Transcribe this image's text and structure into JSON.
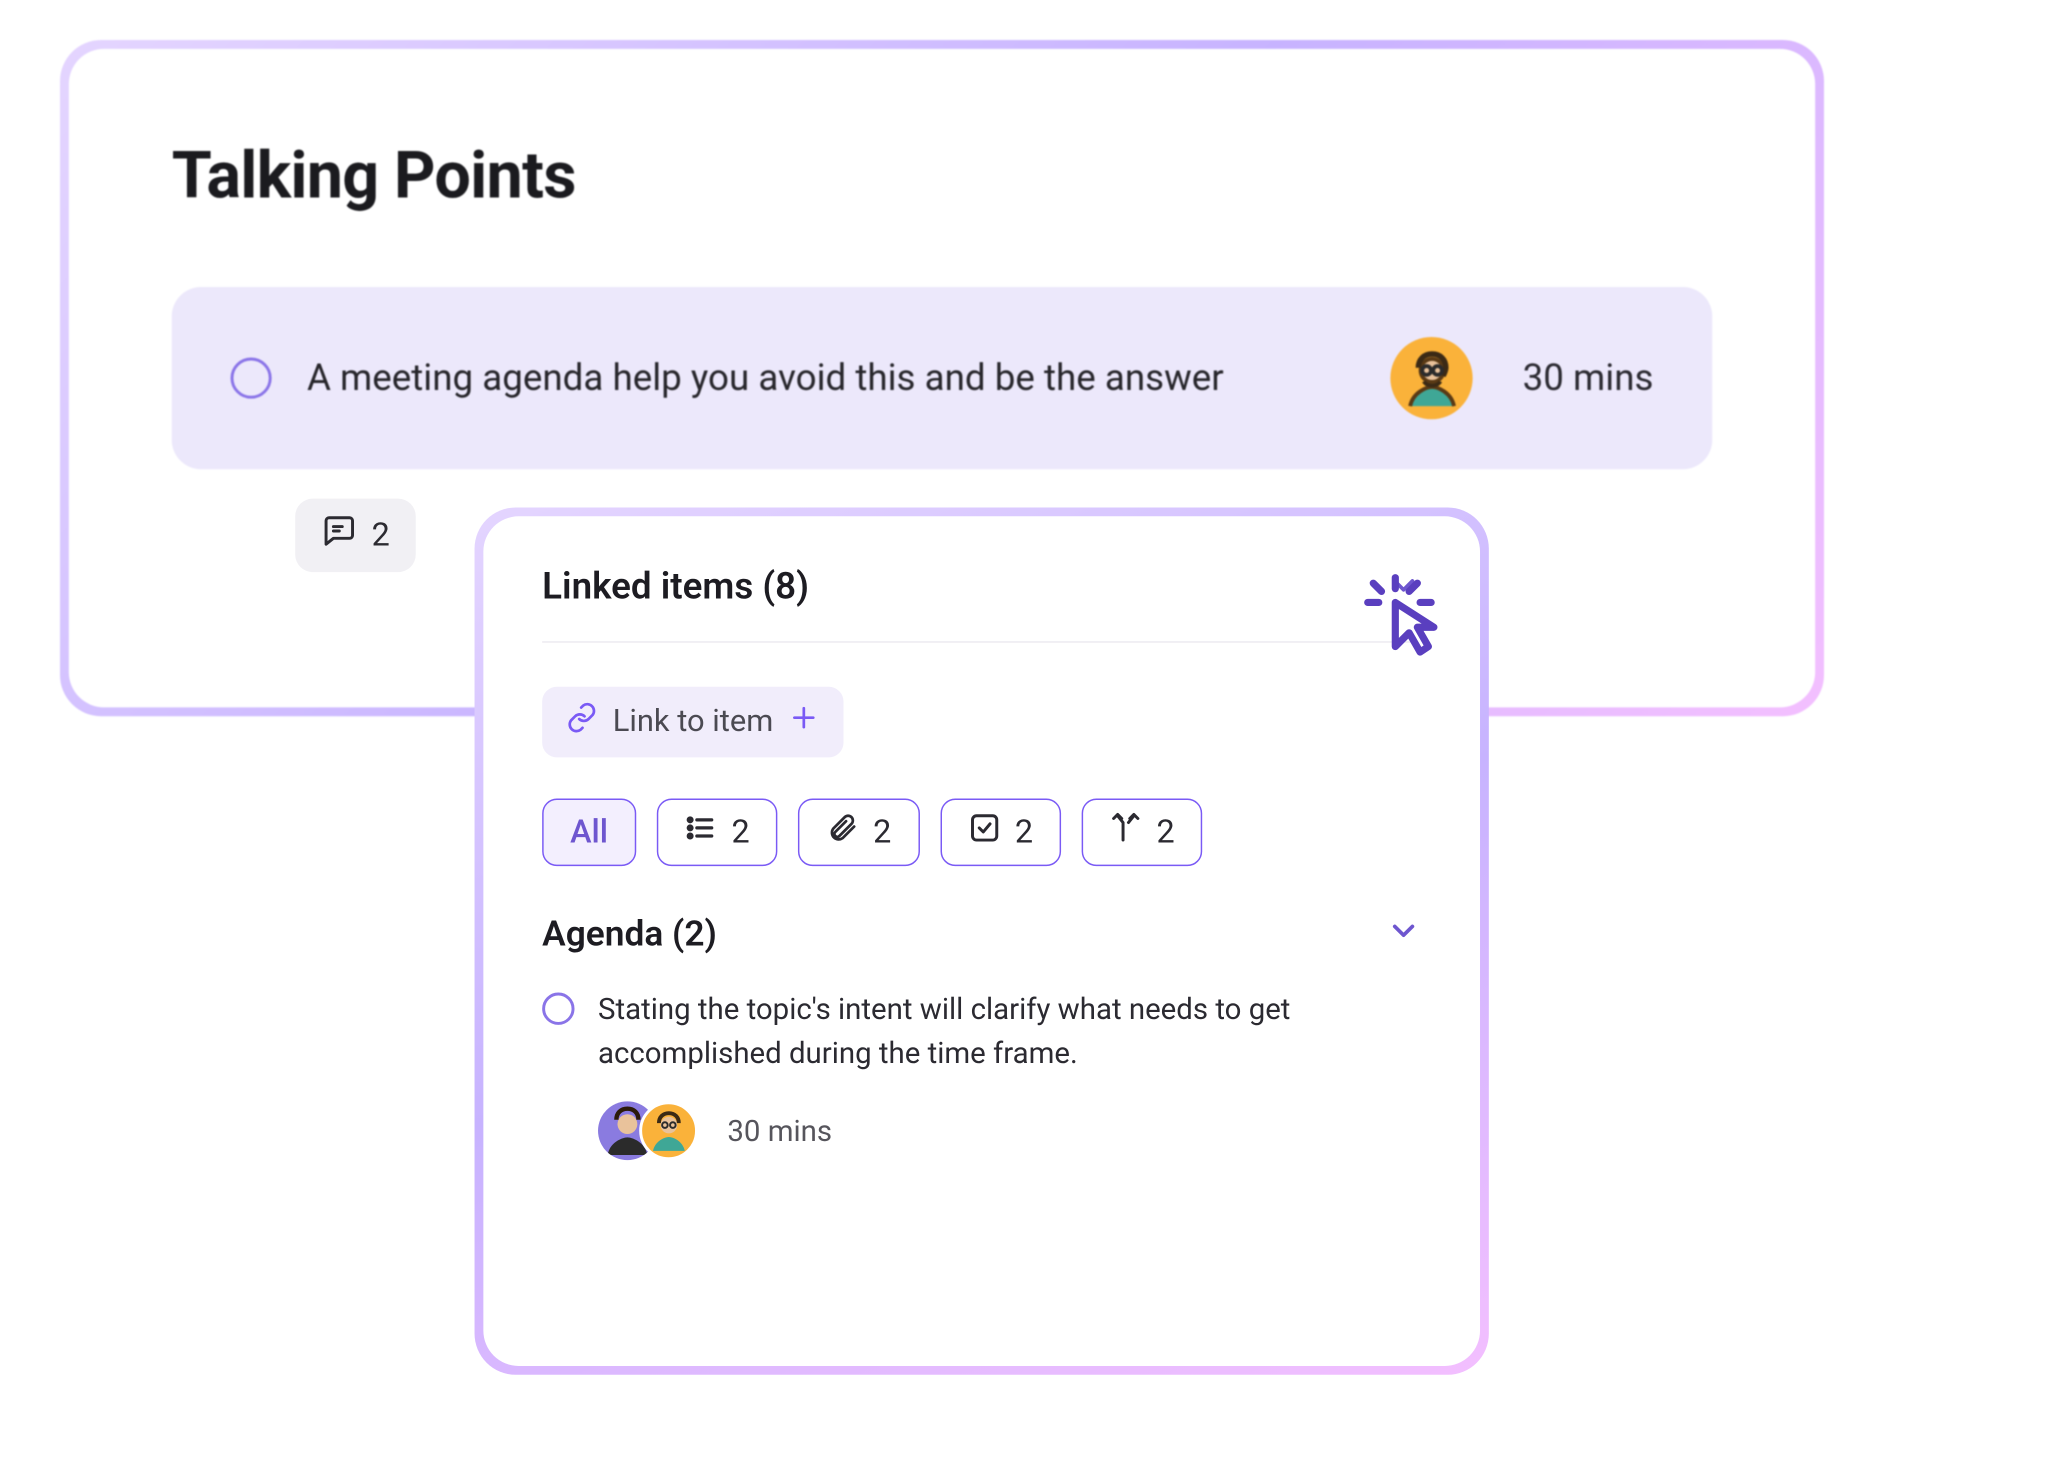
{
  "header": {
    "title": "Talking Points"
  },
  "talking_point": {
    "text": "A meeting agenda help you avoid this and be the answer",
    "duration": "30 mins",
    "comment_count": "2"
  },
  "linked_items": {
    "header": "Linked items (8)",
    "link_to_item_label": "Link to item",
    "filters": {
      "all": "All",
      "list_count": "2",
      "attach_count": "2",
      "check_count": "2",
      "branch_count": "2"
    },
    "agenda": {
      "header": "Agenda (2)",
      "item_text": "Stating the topic's intent will clarify what needs to get accomplished during the time frame.",
      "item_duration": "30 mins"
    }
  }
}
